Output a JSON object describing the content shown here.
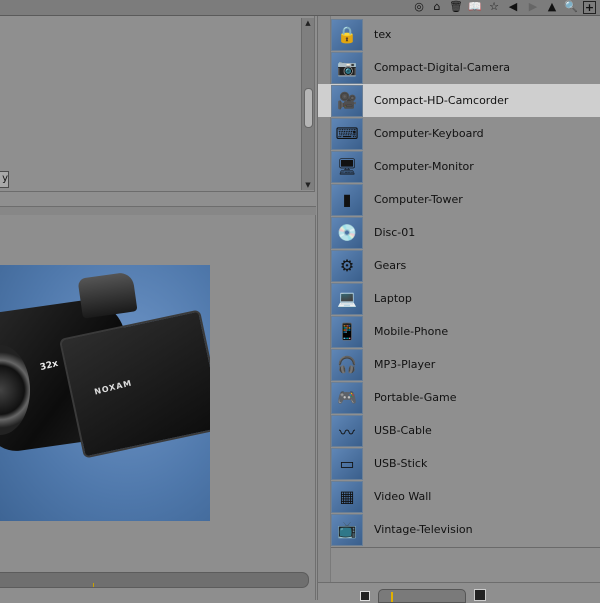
{
  "toolbar": {
    "icons": [
      "view-toggle-icon",
      "home-icon",
      "trash-icon",
      "book-icon",
      "star-icon",
      "back-icon",
      "forward-icon",
      "up-icon",
      "search-icon",
      "add-icon"
    ],
    "glyphs": {
      "view": "◎",
      "home": "⌂",
      "trash": "🗑",
      "book": "📖",
      "star": "☆",
      "back": "◀",
      "forward": "▶",
      "up": "▲",
      "search": "🔍",
      "add": "+"
    }
  },
  "upper_panel": {
    "partial_label": "y"
  },
  "preview": {
    "zoom_text": "32x",
    "brand_text": "NOXAM"
  },
  "asset_list": {
    "selected_index": 2,
    "items": [
      {
        "label": "tex",
        "icon": "folder-lock-icon",
        "glyph": "🔒"
      },
      {
        "label": "Compact-Digital-Camera",
        "icon": "camera-icon",
        "glyph": "📷"
      },
      {
        "label": "Compact-HD-Camcorder",
        "icon": "camcorder-icon",
        "glyph": "🎥"
      },
      {
        "label": "Computer-Keyboard",
        "icon": "keyboard-icon",
        "glyph": "⌨"
      },
      {
        "label": "Computer-Monitor",
        "icon": "monitor-icon",
        "glyph": "🖥"
      },
      {
        "label": "Computer-Tower",
        "icon": "computer-tower-icon",
        "glyph": "▮"
      },
      {
        "label": "Disc-01",
        "icon": "disc-icon",
        "glyph": "💿"
      },
      {
        "label": "Gears",
        "icon": "gears-icon",
        "glyph": "⚙"
      },
      {
        "label": "Laptop",
        "icon": "laptop-icon",
        "glyph": "💻"
      },
      {
        "label": "Mobile-Phone",
        "icon": "mobile-phone-icon",
        "glyph": "📱"
      },
      {
        "label": "MP3-Player",
        "icon": "mp3-player-icon",
        "glyph": "🎧"
      },
      {
        "label": "Portable-Game",
        "icon": "portable-game-icon",
        "glyph": "🎮"
      },
      {
        "label": "USB-Cable",
        "icon": "usb-cable-icon",
        "glyph": "〰"
      },
      {
        "label": "USB-Stick",
        "icon": "usb-stick-icon",
        "glyph": "▭"
      },
      {
        "label": "Video Wall",
        "icon": "video-wall-icon",
        "glyph": "▦"
      },
      {
        "label": "Vintage-Television",
        "icon": "television-icon",
        "glyph": "📺"
      }
    ]
  },
  "colors": {
    "background": "#8f8f8f",
    "selected_row": "#cfcfcf",
    "accent": "#e0b000"
  }
}
